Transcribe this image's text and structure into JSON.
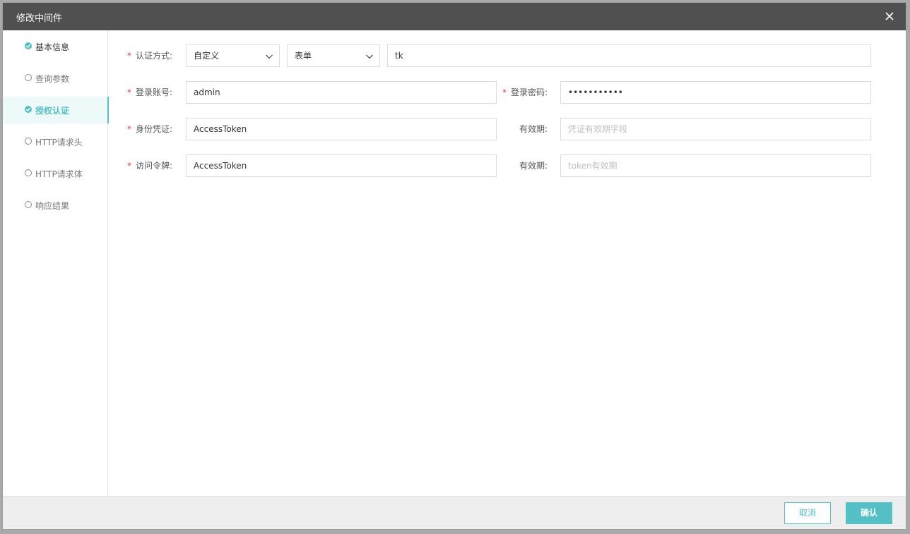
{
  "modal": {
    "title": "修改中间件",
    "cancel_label": "取消",
    "confirm_label": "确认"
  },
  "steps": [
    {
      "label": "基本信息",
      "state": "done"
    },
    {
      "label": "查询参数",
      "state": "todo"
    },
    {
      "label": "授权认证",
      "state": "active"
    },
    {
      "label": "HTTP请求头",
      "state": "todo"
    },
    {
      "label": "HTTP请求体",
      "state": "todo"
    },
    {
      "label": "响应结果",
      "state": "todo"
    }
  ],
  "form": {
    "auth_method": {
      "label": "认证方式:",
      "type_value": "自定义",
      "format_value": "表单",
      "key_value": "tk"
    },
    "login_account": {
      "label": "登录账号:",
      "value": "admin"
    },
    "login_password": {
      "label": "登录密码:",
      "value": "•••••••••••"
    },
    "credential": {
      "label": "身份凭证:",
      "value": "AccessToken",
      "expiry_label": "有效期:",
      "expiry_placeholder": "凭证有效期字段"
    },
    "access_token": {
      "label": "访问令牌:",
      "value": "AccessToken",
      "expiry_label": "有效期:",
      "expiry_placeholder": "token有效期"
    }
  },
  "colors": {
    "accent": "#53c0c6",
    "header": "#505050",
    "required": "#e0393e"
  },
  "icons": {
    "close": "close-icon",
    "check": "check-icon",
    "chevron": "chevron-down-icon"
  }
}
